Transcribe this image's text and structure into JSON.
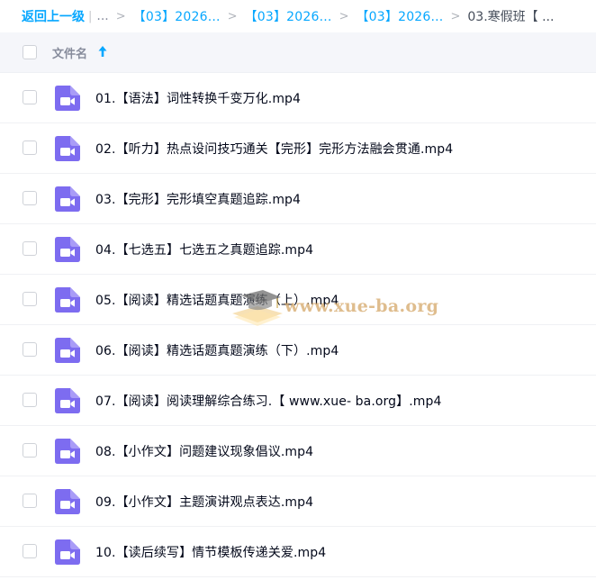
{
  "breadcrumb": {
    "back_label": "返回上一级",
    "pipe": "|",
    "ellipsis": "...",
    "separator": ">",
    "links": [
      "【03】2026...",
      "【03】2026...",
      "【03】2026..."
    ],
    "current": "03.寒假班【 ..."
  },
  "header": {
    "column_label": "文件名"
  },
  "files": [
    {
      "name": "01.【语法】词性转换千变万化.mp4"
    },
    {
      "name": "02.【听力】热点设问技巧通关【完形】完形方法融会贯通.mp4"
    },
    {
      "name": "03.【完形】完形填空真题追踪.mp4"
    },
    {
      "name": "04.【七选五】七选五之真题追踪.mp4"
    },
    {
      "name": "05.【阅读】精选话题真题演练（上）.mp4"
    },
    {
      "name": "06.【阅读】精选话题真题演练（下）.mp4"
    },
    {
      "name": "07.【阅读】阅读理解综合练习.【 www.xue- ba.org】.mp4"
    },
    {
      "name": "08.【小作文】问题建议现象倡议.mp4"
    },
    {
      "name": "09.【小作文】主题演讲观点表达.mp4"
    },
    {
      "name": "10.【读后续写】情节模板传递关爱.mp4"
    }
  ],
  "watermark": {
    "text": "www.xue-ba.org"
  },
  "colors": {
    "accent": "#06a7ff",
    "video_icon": "#7d6cf0",
    "header_bg": "#f5f6fa"
  },
  "icons": {
    "file": "video-file-icon",
    "sort": "sort-arrow-up-icon",
    "watermark_logo": "graduation-cap-book-icon"
  }
}
